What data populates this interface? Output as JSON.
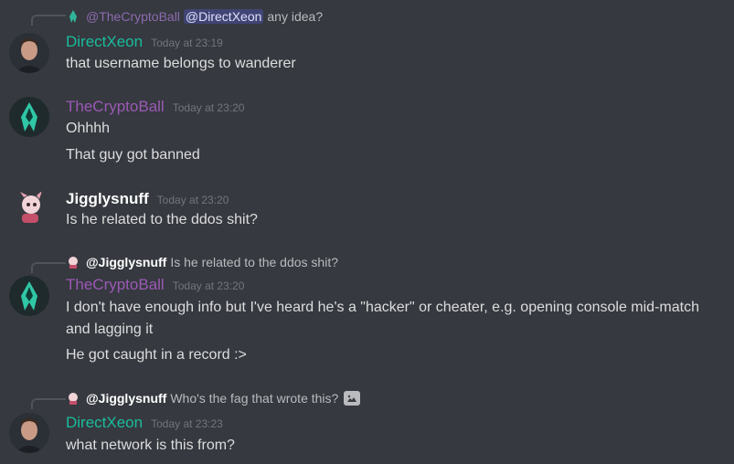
{
  "messages": [
    {
      "reply": {
        "author": "@TheCryptoBall",
        "mention": "@DirectXeon",
        "text": "any idea?"
      },
      "author": "DirectXeon",
      "timestamp": "Today at 23:19",
      "lines": [
        "that username belongs to wanderer"
      ]
    },
    {
      "author": "TheCryptoBall",
      "timestamp": "Today at 23:20",
      "lines": [
        "Ohhhh",
        "That guy got banned"
      ]
    },
    {
      "author": "Jigglysnuff",
      "timestamp": "Today at 23:20",
      "lines": [
        "Is he related to the ddos shit?"
      ]
    },
    {
      "reply": {
        "author": "@Jigglysnuff",
        "text": "Is he related to the ddos shit?"
      },
      "author": "TheCryptoBall",
      "timestamp": "Today at 23:20",
      "lines": [
        "I don't have enough info but I've heard he's a \"hacker\" or cheater, e.g. opening console mid-match and lagging it",
        "He got caught in a record :>"
      ]
    },
    {
      "reply": {
        "author": "@Jigglysnuff",
        "text": "Who's the fag that wrote this?",
        "attachment_icon": "image-icon"
      },
      "author": "DirectXeon",
      "timestamp": "Today at 23:23",
      "lines": [
        "what network is this from?"
      ]
    }
  ],
  "colors": {
    "background": "#36393f",
    "directxeon": "#1abc9c",
    "thecryptoball": "#9b59b6",
    "jigglysnuff": "#ffffff",
    "text": "#dcddde",
    "timestamp": "#72767d"
  }
}
